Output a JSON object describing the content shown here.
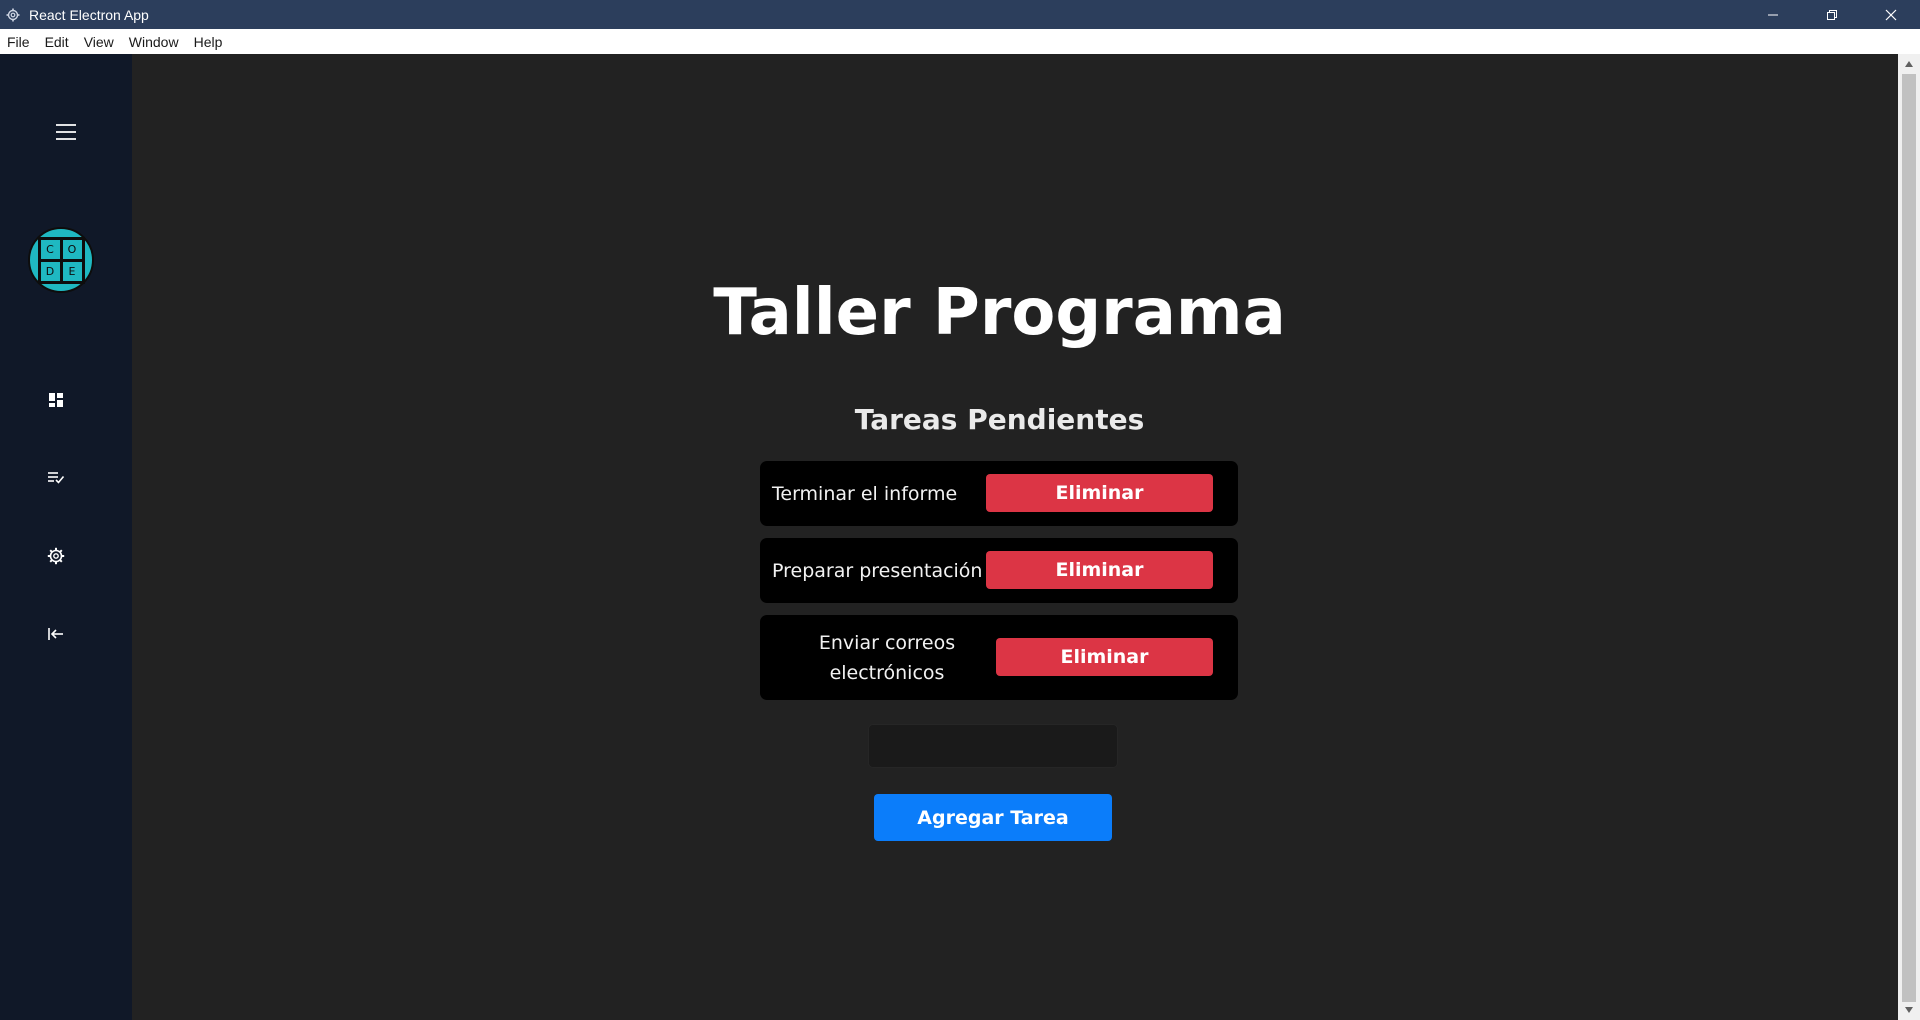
{
  "window": {
    "title": "React Electron App",
    "icon": "electron-gear-icon"
  },
  "menu": [
    "File",
    "Edit",
    "View",
    "Window",
    "Help"
  ],
  "sidebar": {
    "logo_letters": [
      "C",
      "O",
      "D",
      "E"
    ],
    "items": [
      {
        "icon": "dashboard-icon"
      },
      {
        "icon": "task-list-icon"
      },
      {
        "icon": "settings-gear-icon"
      },
      {
        "icon": "logout-icon"
      }
    ]
  },
  "main": {
    "title": "Taller Programa",
    "subtitle": "Tareas Pendientes",
    "tasks": [
      {
        "text": "Terminar el informe",
        "delete_label": "Eliminar"
      },
      {
        "text": "Preparar presentación",
        "delete_label": "Eliminar"
      },
      {
        "text": "Enviar correos electrónicos",
        "delete_label": "Eliminar"
      }
    ],
    "new_task_input": {
      "value": "",
      "placeholder": ""
    },
    "add_button_label": "Agregar Tarea"
  },
  "colors": {
    "titlebar": "#2c3e5c",
    "sidebar": "#101828",
    "background": "#222222",
    "danger": "#dc3545",
    "primary": "#0b7dfa",
    "logo": "#1fb8c1"
  }
}
